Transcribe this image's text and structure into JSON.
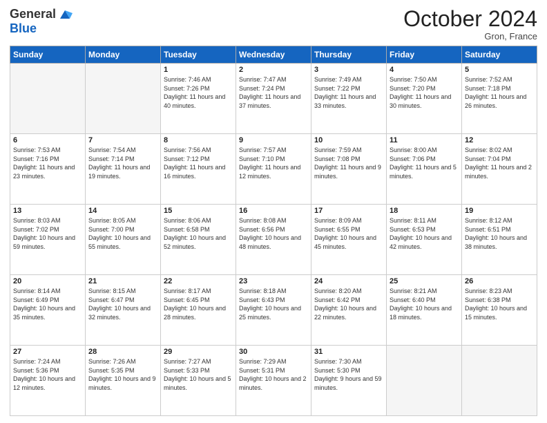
{
  "header": {
    "logo_line1": "General",
    "logo_line2": "Blue",
    "month_title": "October 2024",
    "location": "Gron, France"
  },
  "weekdays": [
    "Sunday",
    "Monday",
    "Tuesday",
    "Wednesday",
    "Thursday",
    "Friday",
    "Saturday"
  ],
  "weeks": [
    [
      {
        "day": "",
        "sunrise": "",
        "sunset": "",
        "daylight": "",
        "empty": true
      },
      {
        "day": "",
        "sunrise": "",
        "sunset": "",
        "daylight": "",
        "empty": true
      },
      {
        "day": "1",
        "sunrise": "Sunrise: 7:46 AM",
        "sunset": "Sunset: 7:26 PM",
        "daylight": "Daylight: 11 hours and 40 minutes.",
        "empty": false
      },
      {
        "day": "2",
        "sunrise": "Sunrise: 7:47 AM",
        "sunset": "Sunset: 7:24 PM",
        "daylight": "Daylight: 11 hours and 37 minutes.",
        "empty": false
      },
      {
        "day": "3",
        "sunrise": "Sunrise: 7:49 AM",
        "sunset": "Sunset: 7:22 PM",
        "daylight": "Daylight: 11 hours and 33 minutes.",
        "empty": false
      },
      {
        "day": "4",
        "sunrise": "Sunrise: 7:50 AM",
        "sunset": "Sunset: 7:20 PM",
        "daylight": "Daylight: 11 hours and 30 minutes.",
        "empty": false
      },
      {
        "day": "5",
        "sunrise": "Sunrise: 7:52 AM",
        "sunset": "Sunset: 7:18 PM",
        "daylight": "Daylight: 11 hours and 26 minutes.",
        "empty": false
      }
    ],
    [
      {
        "day": "6",
        "sunrise": "Sunrise: 7:53 AM",
        "sunset": "Sunset: 7:16 PM",
        "daylight": "Daylight: 11 hours and 23 minutes.",
        "empty": false
      },
      {
        "day": "7",
        "sunrise": "Sunrise: 7:54 AM",
        "sunset": "Sunset: 7:14 PM",
        "daylight": "Daylight: 11 hours and 19 minutes.",
        "empty": false
      },
      {
        "day": "8",
        "sunrise": "Sunrise: 7:56 AM",
        "sunset": "Sunset: 7:12 PM",
        "daylight": "Daylight: 11 hours and 16 minutes.",
        "empty": false
      },
      {
        "day": "9",
        "sunrise": "Sunrise: 7:57 AM",
        "sunset": "Sunset: 7:10 PM",
        "daylight": "Daylight: 11 hours and 12 minutes.",
        "empty": false
      },
      {
        "day": "10",
        "sunrise": "Sunrise: 7:59 AM",
        "sunset": "Sunset: 7:08 PM",
        "daylight": "Daylight: 11 hours and 9 minutes.",
        "empty": false
      },
      {
        "day": "11",
        "sunrise": "Sunrise: 8:00 AM",
        "sunset": "Sunset: 7:06 PM",
        "daylight": "Daylight: 11 hours and 5 minutes.",
        "empty": false
      },
      {
        "day": "12",
        "sunrise": "Sunrise: 8:02 AM",
        "sunset": "Sunset: 7:04 PM",
        "daylight": "Daylight: 11 hours and 2 minutes.",
        "empty": false
      }
    ],
    [
      {
        "day": "13",
        "sunrise": "Sunrise: 8:03 AM",
        "sunset": "Sunset: 7:02 PM",
        "daylight": "Daylight: 10 hours and 59 minutes.",
        "empty": false
      },
      {
        "day": "14",
        "sunrise": "Sunrise: 8:05 AM",
        "sunset": "Sunset: 7:00 PM",
        "daylight": "Daylight: 10 hours and 55 minutes.",
        "empty": false
      },
      {
        "day": "15",
        "sunrise": "Sunrise: 8:06 AM",
        "sunset": "Sunset: 6:58 PM",
        "daylight": "Daylight: 10 hours and 52 minutes.",
        "empty": false
      },
      {
        "day": "16",
        "sunrise": "Sunrise: 8:08 AM",
        "sunset": "Sunset: 6:56 PM",
        "daylight": "Daylight: 10 hours and 48 minutes.",
        "empty": false
      },
      {
        "day": "17",
        "sunrise": "Sunrise: 8:09 AM",
        "sunset": "Sunset: 6:55 PM",
        "daylight": "Daylight: 10 hours and 45 minutes.",
        "empty": false
      },
      {
        "day": "18",
        "sunrise": "Sunrise: 8:11 AM",
        "sunset": "Sunset: 6:53 PM",
        "daylight": "Daylight: 10 hours and 42 minutes.",
        "empty": false
      },
      {
        "day": "19",
        "sunrise": "Sunrise: 8:12 AM",
        "sunset": "Sunset: 6:51 PM",
        "daylight": "Daylight: 10 hours and 38 minutes.",
        "empty": false
      }
    ],
    [
      {
        "day": "20",
        "sunrise": "Sunrise: 8:14 AM",
        "sunset": "Sunset: 6:49 PM",
        "daylight": "Daylight: 10 hours and 35 minutes.",
        "empty": false
      },
      {
        "day": "21",
        "sunrise": "Sunrise: 8:15 AM",
        "sunset": "Sunset: 6:47 PM",
        "daylight": "Daylight: 10 hours and 32 minutes.",
        "empty": false
      },
      {
        "day": "22",
        "sunrise": "Sunrise: 8:17 AM",
        "sunset": "Sunset: 6:45 PM",
        "daylight": "Daylight: 10 hours and 28 minutes.",
        "empty": false
      },
      {
        "day": "23",
        "sunrise": "Sunrise: 8:18 AM",
        "sunset": "Sunset: 6:43 PM",
        "daylight": "Daylight: 10 hours and 25 minutes.",
        "empty": false
      },
      {
        "day": "24",
        "sunrise": "Sunrise: 8:20 AM",
        "sunset": "Sunset: 6:42 PM",
        "daylight": "Daylight: 10 hours and 22 minutes.",
        "empty": false
      },
      {
        "day": "25",
        "sunrise": "Sunrise: 8:21 AM",
        "sunset": "Sunset: 6:40 PM",
        "daylight": "Daylight: 10 hours and 18 minutes.",
        "empty": false
      },
      {
        "day": "26",
        "sunrise": "Sunrise: 8:23 AM",
        "sunset": "Sunset: 6:38 PM",
        "daylight": "Daylight: 10 hours and 15 minutes.",
        "empty": false
      }
    ],
    [
      {
        "day": "27",
        "sunrise": "Sunrise: 7:24 AM",
        "sunset": "Sunset: 5:36 PM",
        "daylight": "Daylight: 10 hours and 12 minutes.",
        "empty": false
      },
      {
        "day": "28",
        "sunrise": "Sunrise: 7:26 AM",
        "sunset": "Sunset: 5:35 PM",
        "daylight": "Daylight: 10 hours and 9 minutes.",
        "empty": false
      },
      {
        "day": "29",
        "sunrise": "Sunrise: 7:27 AM",
        "sunset": "Sunset: 5:33 PM",
        "daylight": "Daylight: 10 hours and 5 minutes.",
        "empty": false
      },
      {
        "day": "30",
        "sunrise": "Sunrise: 7:29 AM",
        "sunset": "Sunset: 5:31 PM",
        "daylight": "Daylight: 10 hours and 2 minutes.",
        "empty": false
      },
      {
        "day": "31",
        "sunrise": "Sunrise: 7:30 AM",
        "sunset": "Sunset: 5:30 PM",
        "daylight": "Daylight: 9 hours and 59 minutes.",
        "empty": false
      },
      {
        "day": "",
        "sunrise": "",
        "sunset": "",
        "daylight": "",
        "empty": true
      },
      {
        "day": "",
        "sunrise": "",
        "sunset": "",
        "daylight": "",
        "empty": true
      }
    ]
  ]
}
